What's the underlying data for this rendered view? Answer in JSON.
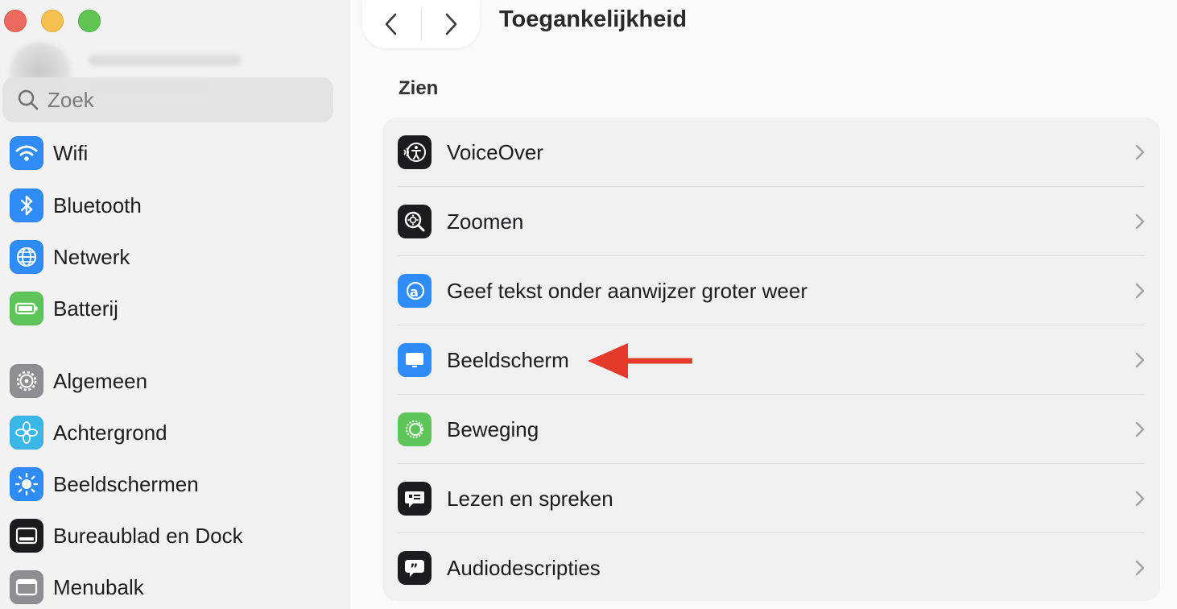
{
  "sidebar": {
    "search_placeholder": "Zoek",
    "items": [
      {
        "label": "Wifi",
        "icon": "wifi-icon",
        "color": "#2f8bf5"
      },
      {
        "label": "Bluetooth",
        "icon": "bluetooth-icon",
        "color": "#2f8bf5"
      },
      {
        "label": "Netwerk",
        "icon": "globe-icon",
        "color": "#2f8bf5"
      },
      {
        "label": "Batterij",
        "icon": "battery-icon",
        "color": "#5fc45a"
      },
      {
        "label": "Algemeen",
        "icon": "gear-icon",
        "color": "#8e8e93"
      },
      {
        "label": "Achtergrond",
        "icon": "flower-icon",
        "color": "#3bb6e8"
      },
      {
        "label": "Beeldschermen",
        "icon": "sun-icon",
        "color": "#2f8bf5"
      },
      {
        "label": "Bureaublad en Dock",
        "icon": "dock-icon",
        "color": "#1c1c1e"
      },
      {
        "label": "Menubalk",
        "icon": "menubar-icon",
        "color": "#8e8e93"
      }
    ]
  },
  "main": {
    "title": "Toegankelijkheid",
    "section": "Zien",
    "rows": [
      {
        "label": "VoiceOver",
        "icon": "voiceover-icon",
        "color": "#1c1c1e"
      },
      {
        "label": "Zoomen",
        "icon": "zoom-icon",
        "color": "#1c1c1e"
      },
      {
        "label": "Geef tekst onder aanwijzer groter weer",
        "icon": "hover-text-icon",
        "color": "#2f8bf5"
      },
      {
        "label": "Beeldscherm",
        "icon": "display-icon",
        "color": "#2f8bf5"
      },
      {
        "label": "Beweging",
        "icon": "motion-icon",
        "color": "#5fc45a"
      },
      {
        "label": "Lezen en spreken",
        "icon": "speech-bubble-icon",
        "color": "#1c1c1e"
      },
      {
        "label": "Audiodescripties",
        "icon": "quote-bubble-icon",
        "color": "#1c1c1e"
      }
    ]
  },
  "annotation": {
    "arrow_color": "#e5392a"
  }
}
